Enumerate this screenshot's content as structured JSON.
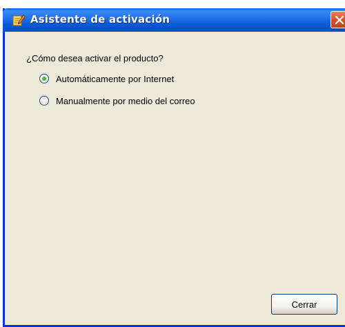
{
  "window": {
    "title": "Asistente de activación",
    "title_icon": "pencil-note-icon",
    "close_icon": "close-icon"
  },
  "content": {
    "question": "¿Cómo desea activar el producto?",
    "options": [
      {
        "label": "Automáticamente por Internet",
        "selected": true
      },
      {
        "label": "Manualmente por medio del correo",
        "selected": false
      }
    ]
  },
  "footer": {
    "close_label": "Cerrar"
  },
  "colors": {
    "titlebar": "#0a5fe6",
    "window_bg": "#ece9d8",
    "close_button_red": "#d8532a",
    "radio_selected": "#2c8a21"
  }
}
